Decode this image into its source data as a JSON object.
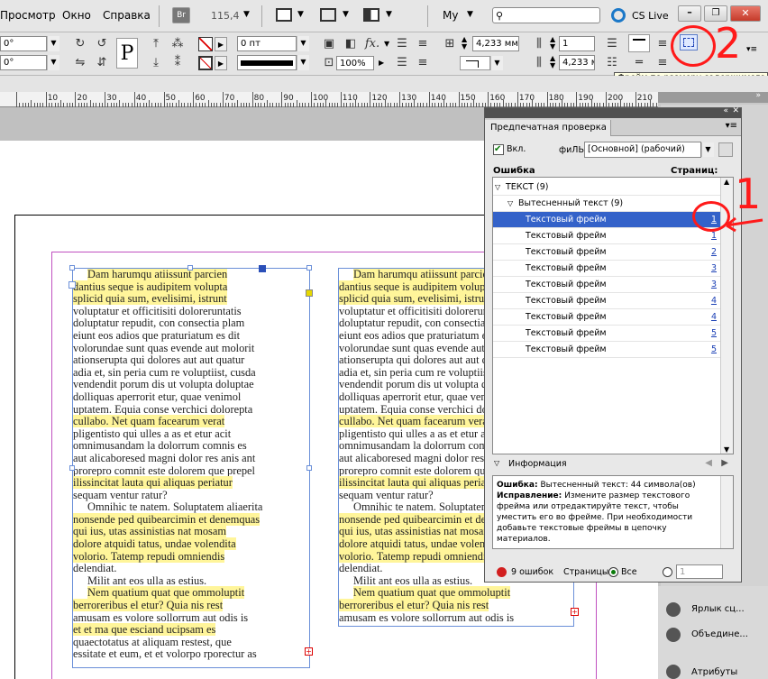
{
  "menu": {
    "items": [
      "Просмотр",
      "Окно",
      "Справка"
    ]
  },
  "apptoolbar": {
    "bridge_label": "Br",
    "zoom_value": "115,4",
    "workspace_label": "My",
    "search_placeholder": "",
    "cslive_label": "CS Live"
  },
  "controlbar": {
    "field_angle1": "0°",
    "field_angle2": "0°",
    "p_glyph": "P",
    "stroke_weight": "0 пт",
    "dim_width": "4,233 мм",
    "dim_height": "4,233 мі",
    "scale_value": "100%",
    "columns_value": "1",
    "tooltip": "Фрейм по размеру содержимого"
  },
  "ruler": {
    "labels": [
      "10",
      "20",
      "30",
      "40",
      "50",
      "60",
      "70",
      "80",
      "90",
      "100",
      "110",
      "120",
      "130",
      "140",
      "150",
      "160",
      "170",
      "180",
      "190",
      "200",
      "210"
    ]
  },
  "document": {
    "left_column": [
      {
        "t": "Dam harumqu atiissunt parcien",
        "h": true,
        "indent": true
      },
      {
        "t": "dantius seque is audipitem volupta",
        "h": true
      },
      {
        "t": "splicid quia sum, evelisimi, istrunt",
        "h": true
      },
      {
        "t": "voluptatur et officitisiti doloreruntatis"
      },
      {
        "t": "doluptatur repudit, con consectia plam"
      },
      {
        "t": "eiunt eos adios que praturiatum es dit"
      },
      {
        "t": "volorundae sunt quas evende aut molorit"
      },
      {
        "t": "ationserupta qui dolores aut aut quatur"
      },
      {
        "t": "adia et, sin peria cum re voluptiist, cusda"
      },
      {
        "t": "vendendit porum dis ut volupta doluptae"
      },
      {
        "t": "dolliquas aperrorit etur, quae venimol"
      },
      {
        "t": "uptatem. Equia conse verchici dolorepta"
      },
      {
        "t": "cullabo. Net quam facearum verat",
        "h": true
      },
      {
        "t": "pligentisto qui ulles a as et etur acit"
      },
      {
        "t": "omnimusandam la dolorrum comnis es"
      },
      {
        "t": "aut alicaboresed magni dolor res anis ant"
      },
      {
        "t": "prorepro comnit este dolorem que prepel"
      },
      {
        "t": "ilissincitat lauta qui aliquas periatur",
        "h": true
      },
      {
        "t": "sequam ventur ratur?"
      },
      {
        "t": "Omnihic te natem. Soluptatem aliaerita",
        "indent": true
      },
      {
        "t": "nonsende ped quibearcimin et denemquas",
        "h": true
      },
      {
        "t": "qui ius, utas assinistias nat mosam",
        "h": true
      },
      {
        "t": "dolore atquidi tatus, undae volendita",
        "h": true
      },
      {
        "t": "volorio. Tatemp repudi omniendis",
        "h": true
      },
      {
        "t": "delendiat."
      },
      {
        "t": "Milit ant eos ulla as estius.",
        "indent": true
      },
      {
        "t": "Nem quatium quat que ommoluptit",
        "h": true,
        "indent": true
      },
      {
        "t": "berroreribus el etur? Quia nis rest",
        "h": true
      },
      {
        "t": "amusam es volore sollorrum aut odis is"
      },
      {
        "t": "et et ma que esciand ucipsam es",
        "h": true
      },
      {
        "t": "quaectotatus at aliquam restest, que"
      },
      {
        "t": "essitate et eum, et et volorpo rporectur as"
      }
    ],
    "right_column": [
      {
        "t": "Dam harumqu atiissunt parcien",
        "h": true,
        "indent": true
      },
      {
        "t": "dantius seque is audipitem volupta",
        "h": true
      },
      {
        "t": "splicid quia sum, evelisimi, istrunt",
        "h": true
      },
      {
        "t": "voluptatur et officitisiti doloreruntatis"
      },
      {
        "t": "doluptatur repudit, con consectia plam"
      },
      {
        "t": "eiunt eos adios que praturiatum es dit"
      },
      {
        "t": "volorundae sunt quas evende aut molorit"
      },
      {
        "t": "ationserupta qui dolores aut aut quatur"
      },
      {
        "t": "adia et, sin peria cum re voluptiist, cusda"
      },
      {
        "t": "vendendit porum dis ut volupta doluptae"
      },
      {
        "t": "dolliquas aperrorit etur, quae venimol"
      },
      {
        "t": "uptatem. Equia conse verchici dolorepta"
      },
      {
        "t": "cullabo. Net quam facearum verat",
        "h": true
      },
      {
        "t": "pligentisto qui ulles a as et etur acit"
      },
      {
        "t": "omnimusandam la dolorrum comnis es"
      },
      {
        "t": "aut alicaboresed magni dolor res anis ant"
      },
      {
        "t": "prorepro comnit este dolorem que prepel"
      },
      {
        "t": "ilissincitat lauta qui aliquas periatur",
        "h": true
      },
      {
        "t": "sequam ventur ratur?"
      },
      {
        "t": "Omnihic te natem. Soluptatem aliaerita",
        "indent": true
      },
      {
        "t": "nonsende ped quibearcimin et denemquas",
        "h": true
      },
      {
        "t": "qui ius, utas assinistias nat mosam",
        "h": true
      },
      {
        "t": "dolore atquidi tatus, undae volendita",
        "h": true
      },
      {
        "t": "volorio. Tatemp repudi omniendis",
        "h": true
      },
      {
        "t": "delendiat."
      },
      {
        "t": "Milit ant eos ulla as estius.",
        "indent": true
      },
      {
        "t": "Nem quatium quat que ommoluptit",
        "h": true,
        "indent": true
      },
      {
        "t": "berroreribus el etur? Quia nis rest",
        "h": true
      },
      {
        "t": "amusam es volore sollorrum aut odis is"
      }
    ]
  },
  "preflight": {
    "title": "Предпечатная проверка",
    "on_label": "Вкл.",
    "profile_label": "фиЛЬ:",
    "profile_value": "[Основной] (рабочий)",
    "col_error": "Ошибка",
    "col_page": "Страниц:",
    "group_text": "ТЕКСТ (9)",
    "subgroup": "Вытесненный текст (9)",
    "rows": [
      {
        "label": "Текстовый фрейм",
        "page": "1",
        "selected": true
      },
      {
        "label": "Текстовый фрейм",
        "page": "1"
      },
      {
        "label": "Текстовый фрейм",
        "page": "2"
      },
      {
        "label": "Текстовый фрейм",
        "page": "3"
      },
      {
        "label": "Текстовый фрейм",
        "page": "3"
      },
      {
        "label": "Текстовый фрейм",
        "page": "4"
      },
      {
        "label": "Текстовый фрейм",
        "page": "4"
      },
      {
        "label": "Текстовый фрейм",
        "page": "5"
      },
      {
        "label": "Текстовый фрейм",
        "page": "5"
      }
    ],
    "info_label": "Информация",
    "info_error_label": "Ошибка:",
    "info_error_text": "Вытесненный текст: 44 символа(ов)",
    "info_fix_label": "Исправление:",
    "info_fix_text": "Измените размер текстового фрейма или отредактируйте текст, чтобы уместить его во фрейме. При необходимости добавьте текстовые фреймы в цепочку материалов.",
    "status_errors": "9 ошибок",
    "pages_label": "Страницы:",
    "all_label": "Все",
    "page_range_value": "1"
  },
  "dock": {
    "items": [
      "Ярлык сц...",
      "Объедине...",
      "Атрибуты"
    ]
  },
  "annotations": {
    "num1": "1",
    "num2": "2"
  },
  "colors": {
    "selection": "#3462c9",
    "highlight": "#fff59a",
    "frame_border": "#6a8fd8",
    "annotation": "#ff1a1a"
  }
}
